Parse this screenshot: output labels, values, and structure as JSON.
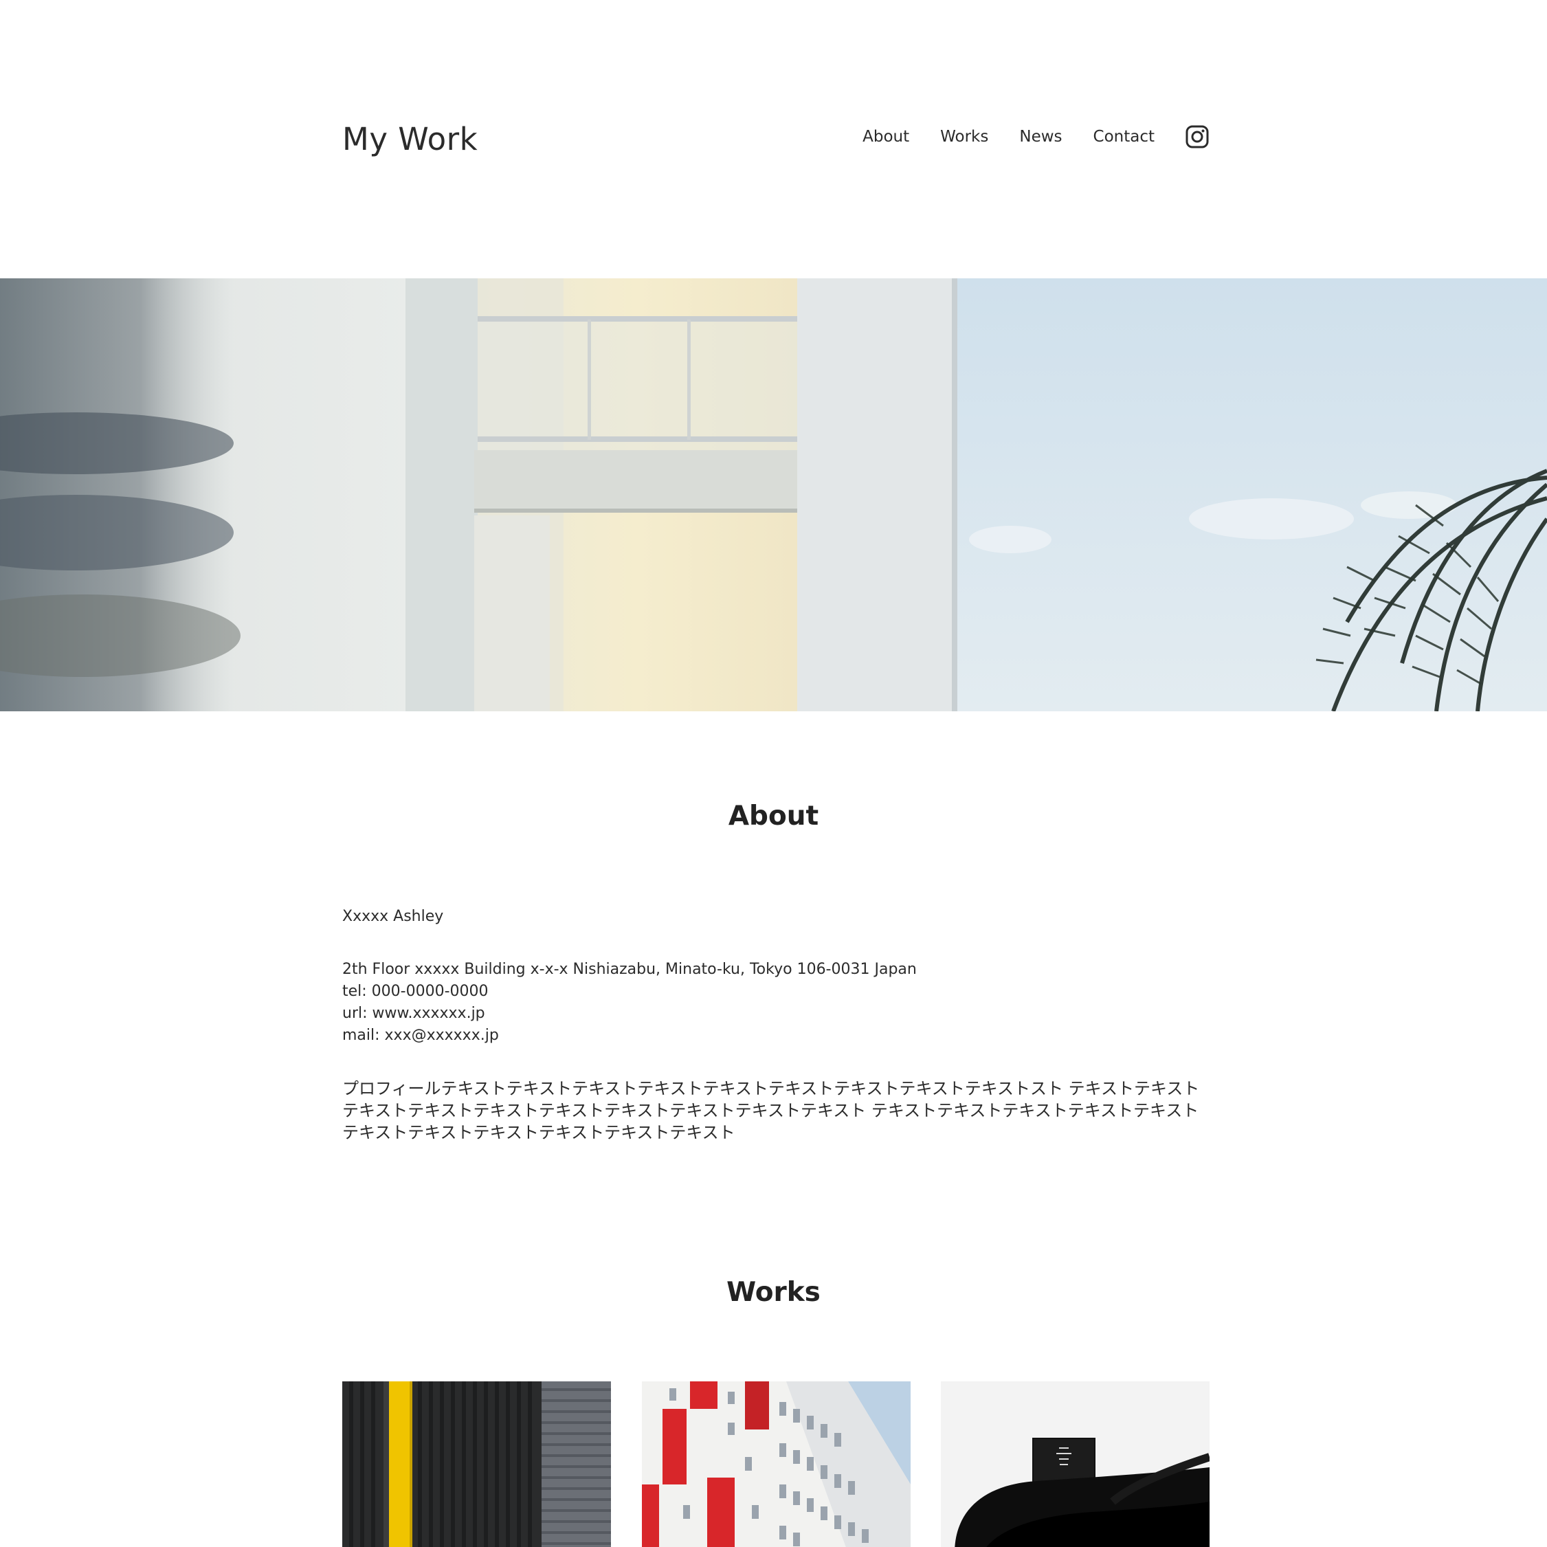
{
  "header": {
    "logo": "My Work",
    "nav": [
      {
        "label": "About"
      },
      {
        "label": "Works"
      },
      {
        "label": "News"
      },
      {
        "label": "Contact"
      }
    ],
    "social_icon": "instagram-icon"
  },
  "about": {
    "title": "About",
    "name": "Xxxxx Ashley",
    "address": "2th Floor xxxxx Building x-x-x Nishiazabu, Minato-ku, Tokyo 106-0031 Japan",
    "tel": "tel: 000-0000-0000",
    "url": "url: www.xxxxxx.jp",
    "mail": "mail: xxx@xxxxxx.jp",
    "profile": "プロフィールテキストテキストテキストテキストテキストテキストテキストテキストテキストスト テキストテキストテキストテキストテキストテキストテキストテキストテキストテキスト テキストテキストテキストテキストテキストテキストテキストテキストテキストテキストテキスト"
  },
  "works": {
    "title": "Works"
  },
  "colors": {
    "text": "#222222",
    "background": "#ffffff"
  }
}
